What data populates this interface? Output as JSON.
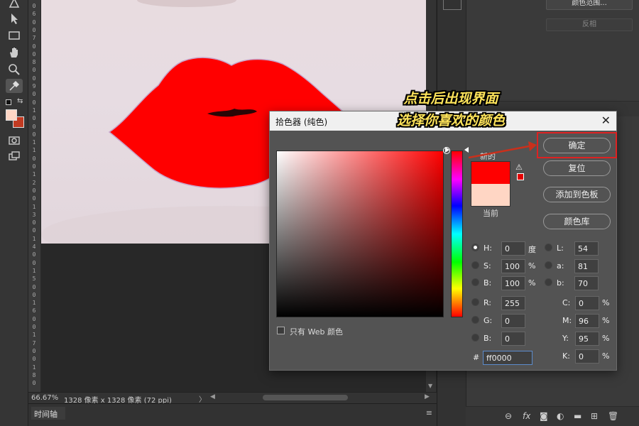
{
  "status_bar": {
    "zoom": "66.67%",
    "doc_info": "1328 像素 x 1328 像素 (72 ppi)"
  },
  "timeline": {
    "tab_label": "时间轴"
  },
  "right_panel": {
    "color_range_button": "颜色范围...",
    "invert_button": "反相"
  },
  "annotation": {
    "line1": "点击后出现界面",
    "line2": "选择你喜欢的颜色"
  },
  "ruler": {
    "ticks": [
      "0",
      "6",
      "0",
      "0",
      "7",
      "0",
      "0",
      "8",
      "0",
      "0",
      "9",
      "0",
      "0",
      "1",
      "0",
      "0",
      "0",
      "1",
      "1",
      "0",
      "0",
      "1",
      "2",
      "0",
      "0",
      "1",
      "3",
      "0",
      "0",
      "1",
      "4",
      "0",
      "0",
      "1",
      "5",
      "0",
      "0",
      "1",
      "6",
      "0",
      "0",
      "1",
      "7",
      "0",
      "0",
      "1",
      "8",
      "0"
    ]
  },
  "picker": {
    "title": "拾色器 (纯色)",
    "new_label": "新的",
    "current_label": "当前",
    "new_color": "#ff0000",
    "current_color": "#ffd6c4",
    "buttons": {
      "ok": "确定",
      "reset": "复位",
      "add_to_swatches": "添加到色板",
      "color_libraries": "颜色库"
    },
    "web_only_label": "只有 Web 颜色",
    "hsb": {
      "h_label": "H:",
      "h_value": "0",
      "h_unit": "度",
      "s_label": "S:",
      "s_value": "100",
      "s_unit": "%",
      "b_label": "B:",
      "b_value": "100",
      "b_unit": "%"
    },
    "lab": {
      "l_label": "L:",
      "l_value": "54",
      "a_label": "a:",
      "a_value": "81",
      "b_label": "b:",
      "b_value": "70"
    },
    "rgb": {
      "r_label": "R:",
      "r_value": "255",
      "g_label": "G:",
      "g_value": "0",
      "b_label": "B:",
      "b_value": "0"
    },
    "cmyk": {
      "c_label": "C:",
      "c_value": "0",
      "c_unit": "%",
      "m_label": "M:",
      "m_value": "96",
      "m_unit": "%",
      "y_label": "Y:",
      "y_value": "95",
      "y_unit": "%",
      "k_label": "K:",
      "k_value": "0",
      "k_unit": "%"
    },
    "hex_prefix": "#",
    "hex_value": "ff0000"
  },
  "colors": {
    "accent_highlight": "#dd2222",
    "annotation_text": "#ffe45a",
    "lip_fill": "#ff0000"
  }
}
